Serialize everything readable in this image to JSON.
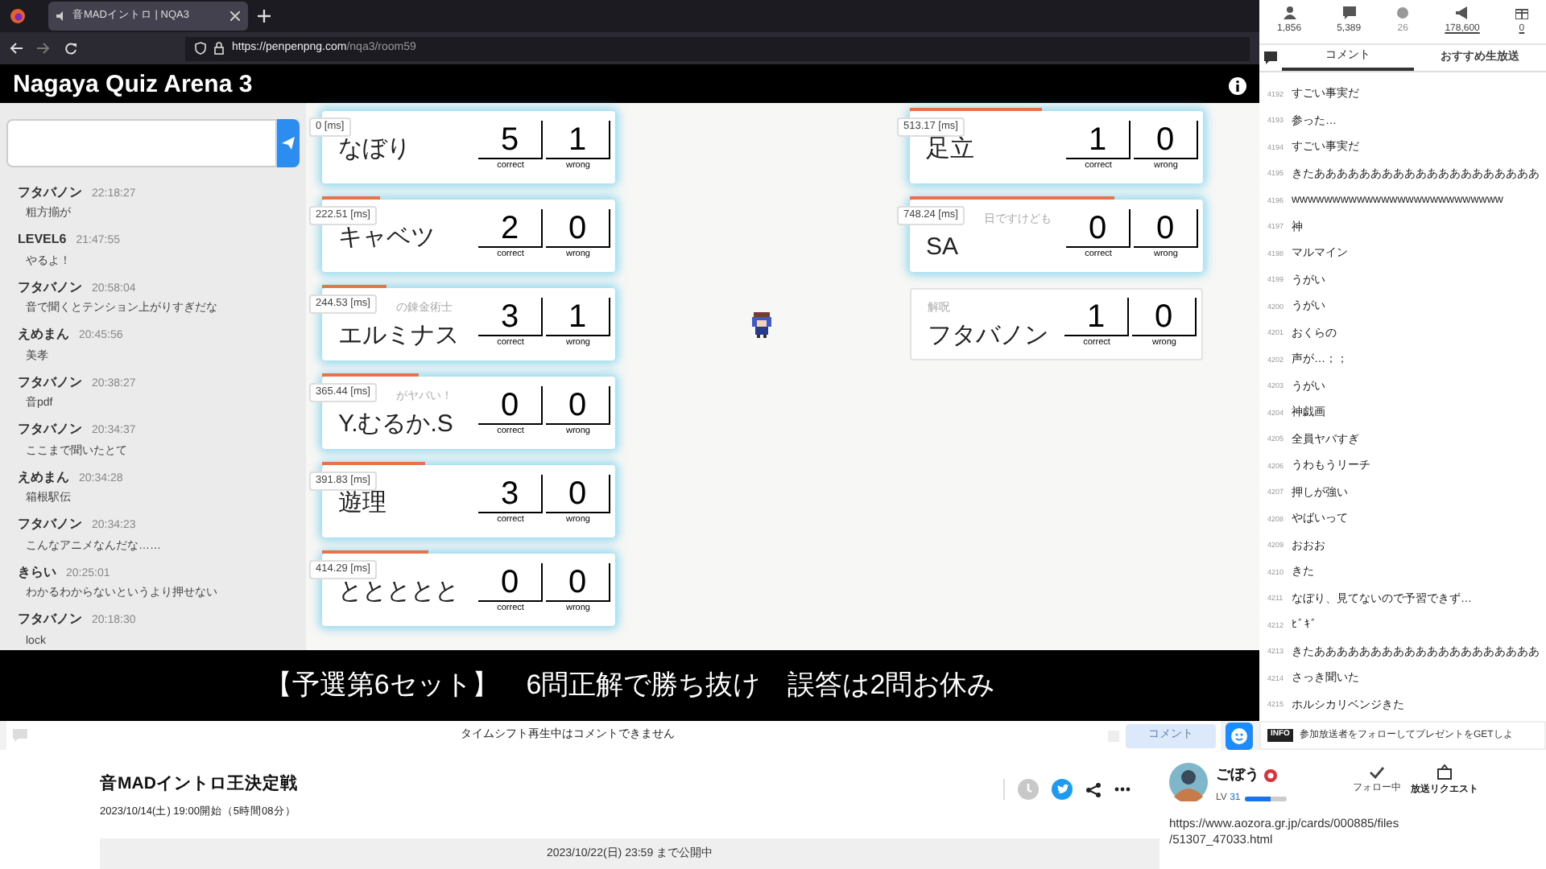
{
  "browser": {
    "tab_title": "音MADイントロ | NQA3",
    "url_host": "https://penpenpng.com",
    "url_path": "/nqa3/room59"
  },
  "site": {
    "title": "Nagaya Quiz Arena 3"
  },
  "chat": {
    "messages": [
      {
        "name": "フタバノン",
        "time": "22:18:27",
        "text": "粗方揃が"
      },
      {
        "name": "LEVEL6",
        "time": "21:47:55",
        "text": "やるよ！"
      },
      {
        "name": "フタバノン",
        "time": "20:58:04",
        "text": "音で聞くとテンション上がりすぎだな"
      },
      {
        "name": "えめまん",
        "time": "20:45:56",
        "text": "美孝"
      },
      {
        "name": "フタバノン",
        "time": "20:38:27",
        "text": "音pdf"
      },
      {
        "name": "フタバノン",
        "time": "20:34:37",
        "text": "ここまで聞いたとて"
      },
      {
        "name": "えめまん",
        "time": "20:34:28",
        "text": "箱根駅伝"
      },
      {
        "name": "フタバノン",
        "time": "20:34:23",
        "text": "こんなアニメなんだな……"
      },
      {
        "name": "きらい",
        "time": "20:25:01",
        "text": "わかるわからないというより押せない"
      },
      {
        "name": "フタバノン",
        "time": "20:18:30",
        "text": "lock"
      }
    ]
  },
  "players_left": [
    {
      "name": "なぼり",
      "time": "0 [ms]",
      "correct": "5",
      "correct_label": "correct",
      "wrong": "1",
      "wrong_label": "wrong",
      "glow": true
    },
    {
      "name": "キャベツ",
      "time": "222.51 [ms]",
      "correct": "2",
      "correct_label": "correct",
      "wrong": "0",
      "wrong_label": "wrong",
      "glow": true,
      "bar": {
        "level": 0.2
      }
    },
    {
      "name": "エルミナス",
      "subtitle": "の錬金術士",
      "time": "244.53 [ms]",
      "correct": "3",
      "correct_label": "correct",
      "wrong": "1",
      "wrong_label": "wrong",
      "glow": true,
      "bar": {
        "level": 0.22
      }
    },
    {
      "name": "Y.むるか.S",
      "subtitle": "がヤバい！",
      "time": "365.44 [ms]",
      "correct": "0",
      "correct_label": "correct",
      "wrong": "0",
      "wrong_label": "wrong",
      "glow": true,
      "bar": {
        "level": 0.33
      }
    },
    {
      "name": "遊理",
      "time": "391.83 [ms]",
      "correct": "3",
      "correct_label": "correct",
      "wrong": "0",
      "wrong_label": "wrong",
      "glow": true,
      "bar": {
        "level": 0.35
      }
    },
    {
      "name": "ととととと",
      "time": "414.29 [ms]",
      "correct": "0",
      "correct_label": "correct",
      "wrong": "0",
      "wrong_label": "wrong",
      "glow": true,
      "bar": {
        "level": 0.36
      }
    }
  ],
  "players_right": [
    {
      "name": "足立",
      "time": "513.17 [ms]",
      "correct": "1",
      "correct_label": "correct",
      "wrong": "0",
      "wrong_label": "wrong",
      "glow": true,
      "bar": {
        "level": 0.45
      }
    },
    {
      "name": "SA",
      "subtitle": "日ですけども",
      "time": "748.24 [ms]",
      "correct": "0",
      "correct_label": "correct",
      "wrong": "0",
      "wrong_label": "wrong",
      "glow": true,
      "bar": {
        "level": 0.7
      }
    },
    {
      "name": "フタバノン",
      "subtitle": "解呪",
      "correct": "1",
      "correct_label": "correct",
      "wrong": "0",
      "wrong_label": "wrong",
      "glow": false
    }
  ],
  "caption": "【予選第6セット】　6問正解で勝ち抜け　誤答は2問お休み",
  "stats": [
    {
      "kind": "person",
      "value": "1,856",
      "disabled": false,
      "link": false
    },
    {
      "kind": "comment",
      "value": "5,389",
      "disabled": false,
      "link": false
    },
    {
      "kind": "dot",
      "value": "26",
      "disabled": true,
      "link": false
    },
    {
      "kind": "megaphone",
      "value": "178,600",
      "disabled": false,
      "link": true
    },
    {
      "kind": "gift",
      "value": "0",
      "disabled": false,
      "link": true
    }
  ],
  "comment_tabs": [
    {
      "label": "コメント",
      "selected": true
    },
    {
      "label": "おすすめ生放送",
      "selected": false
    }
  ],
  "comments": [
    {
      "no": "4192",
      "text": "すごい事実だ"
    },
    {
      "no": "4193",
      "text": "参った…"
    },
    {
      "no": "4194",
      "text": "すごい事実だ"
    },
    {
      "no": "4195",
      "text": "きたああああああああああああああああああああ"
    },
    {
      "no": "4196",
      "text": "wwwwwwwwwwwwwwwwwwwwwwwwww"
    },
    {
      "no": "4197",
      "text": "神"
    },
    {
      "no": "4198",
      "text": "マルマイン"
    },
    {
      "no": "4199",
      "text": "うがい"
    },
    {
      "no": "4200",
      "text": "うがい"
    },
    {
      "no": "4201",
      "text": "おくらの"
    },
    {
      "no": "4202",
      "text": "声が…；；"
    },
    {
      "no": "4203",
      "text": "うがい"
    },
    {
      "no": "4204",
      "text": "神戯画"
    },
    {
      "no": "4205",
      "text": "全員ヤバすぎ"
    },
    {
      "no": "4206",
      "text": "うわもうリーチ"
    },
    {
      "no": "4207",
      "text": "押しが強い"
    },
    {
      "no": "4208",
      "text": "やばいって"
    },
    {
      "no": "4209",
      "text": "おおお"
    },
    {
      "no": "4210",
      "text": "きた"
    },
    {
      "no": "4211",
      "text": "なぼり、見てないので予習できず…"
    },
    {
      "no": "4212",
      "text": "ﾋﾞｷﾞ"
    },
    {
      "no": "4213",
      "text": "きたああああああああああああああああああああ"
    },
    {
      "no": "4214",
      "text": "さっき聞いた"
    },
    {
      "no": "4215",
      "text": "ホルシカリベンジきた"
    }
  ],
  "info": {
    "badge": "INFO",
    "text": "参加放送者をフォローしてプレゼントをGETしよ"
  },
  "comment_bar": {
    "notice": "タイムシフト再生中はコメントできません",
    "button": "コメント",
    "button_disabled": true
  },
  "program": {
    "title": "音MADイントロ王決定戦",
    "date": "2023/10/14(土) 19:00開始（5時間08分）",
    "availability": "2023/10/22(日) 23:59 まで公開中"
  },
  "broadcaster": {
    "name": "ごぼう",
    "level_label": "LV",
    "level_value": "31",
    "progress": {
      "level": 0.6
    },
    "follow": "フォロー中",
    "request": "放送リクエスト",
    "description": [
      "https://www.aozora.gr.jp/cards/000885/files",
      "/51307_47033.html"
    ]
  }
}
